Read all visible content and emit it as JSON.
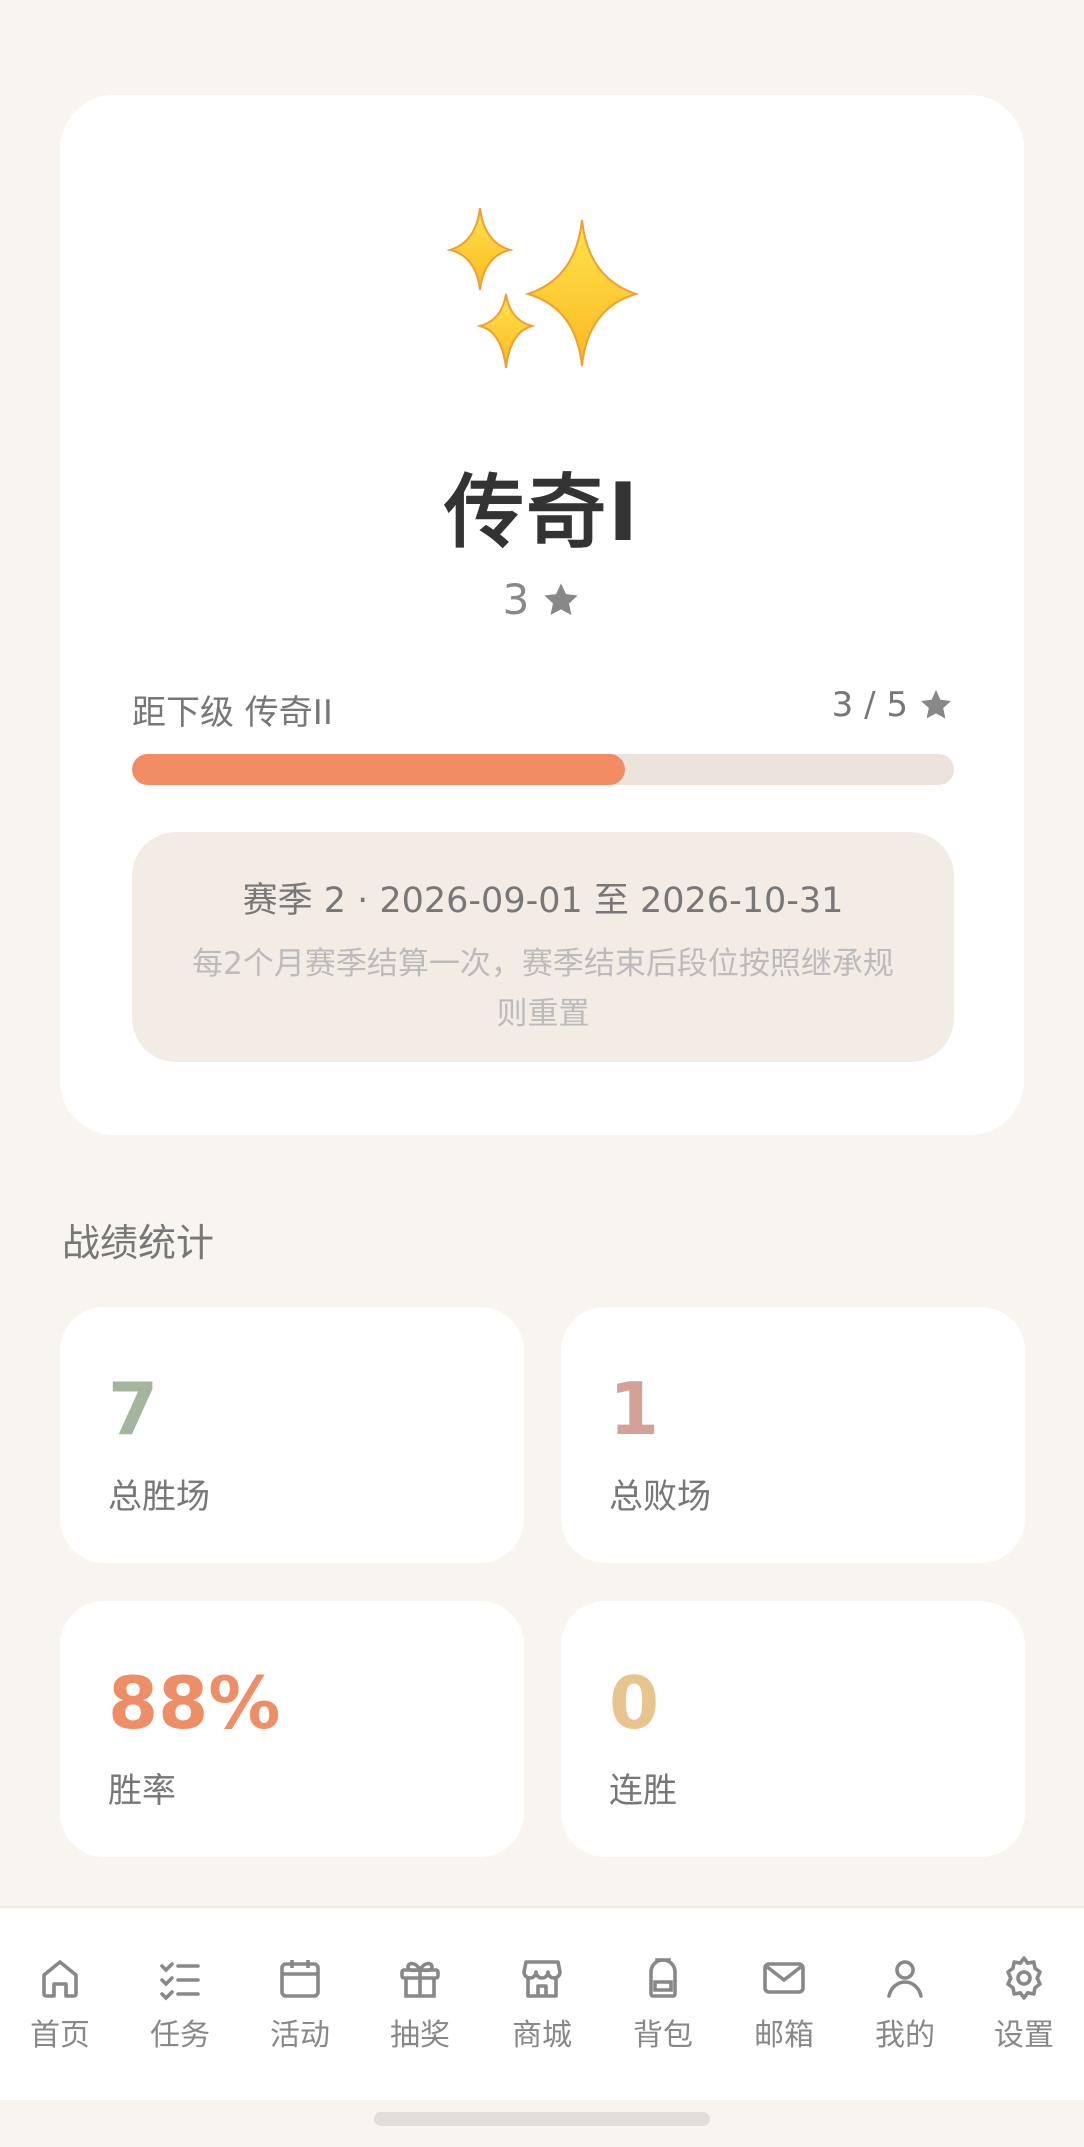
{
  "rank": {
    "name": "传奇I",
    "stars": "3",
    "next_label": "距下级 传奇II",
    "next_progress": "3 / 5",
    "progress_fraction": 0.6
  },
  "season": {
    "title": "赛季 2 · 2026-09-01 至 2026-10-31",
    "note": "每2个月赛季结算一次，赛季结束后段位按照继承规则重置"
  },
  "stats": {
    "section_title": "战绩统计",
    "wins": {
      "value": "7",
      "label": "总胜场",
      "color": "#a3b59c"
    },
    "losses": {
      "value": "1",
      "label": "总败场",
      "color": "#d4a196"
    },
    "win_rate": {
      "value": "88%",
      "label": "胜率",
      "color": "#ee8e66"
    },
    "streak": {
      "value": "0",
      "label": "连胜",
      "color": "#e8c48e"
    }
  },
  "tabbar": [
    {
      "label": "首页",
      "icon": "home-icon"
    },
    {
      "label": "任务",
      "icon": "checklist-icon"
    },
    {
      "label": "活动",
      "icon": "calendar-icon"
    },
    {
      "label": "抽奖",
      "icon": "gift-icon"
    },
    {
      "label": "商城",
      "icon": "store-icon"
    },
    {
      "label": "背包",
      "icon": "backpack-icon"
    },
    {
      "label": "邮箱",
      "icon": "mail-icon"
    },
    {
      "label": "我的",
      "icon": "user-icon"
    },
    {
      "label": "设置",
      "icon": "gear-icon"
    }
  ]
}
